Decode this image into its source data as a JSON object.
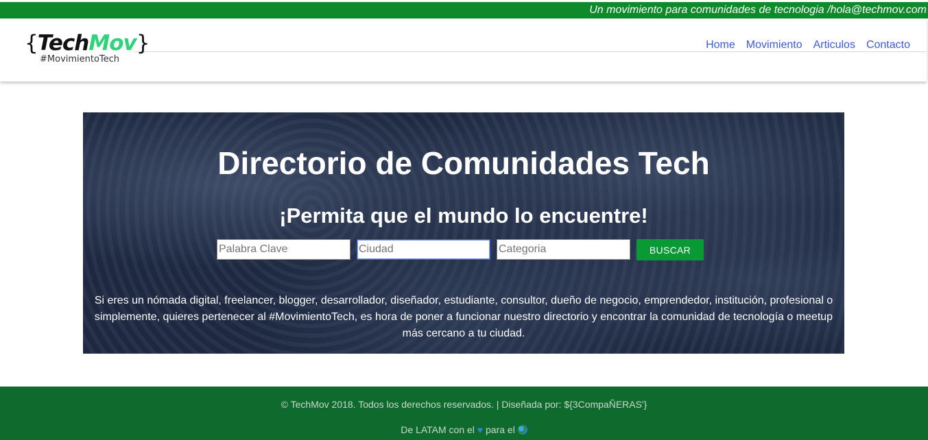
{
  "header": {
    "tagline": "Un movimiento para comunidades de tecnologia /hola@techmov.com",
    "logo": {
      "brace_open": "{",
      "tech": "Tech",
      "mov": "Mov",
      "brace_close": "}",
      "hashtag": "#MovimientoTech"
    },
    "nav": [
      "Home",
      "Movimiento",
      "Articulos",
      "Contacto"
    ]
  },
  "hero": {
    "title": "Directorio de Comunidades Tech",
    "subtitle": "¡Permita que el mundo lo encuentre!",
    "search": {
      "keyword_placeholder": "Palabra Clave",
      "city_placeholder": "Ciudad",
      "category_placeholder": "Categoria",
      "button_label": "BUSCAR"
    },
    "description": "Si eres un nómada digital, freelancer, blogger, desarrollador, diseñador, estudiante, consultor, dueño de negocio, emprendedor, institución, profesional o simplemente, quieres pertenecer al #MovimientoTech, es hora de poner a funcionar nuestro directorio y encontrar la comunidad de tecnología o meetup más cercano a tu ciudad."
  },
  "footer": {
    "copyright": "© TechMov 2018. Todos los derechos reservados. | Diseñada por: ${3CompaÑERAS'}",
    "latam_prefix": "De LATAM con el",
    "latam_middle": "para el",
    "heart_icon": "blue-heart-icon",
    "globe_icon": "globe-americas-icon"
  },
  "colors": {
    "topbar": "#0f8a2b",
    "link": "#3b5bd6",
    "hero_bg": "#1f2b44",
    "button": "#0a9a35",
    "footer": "#0e6b2d",
    "logo_accent": "#2ed37a"
  }
}
